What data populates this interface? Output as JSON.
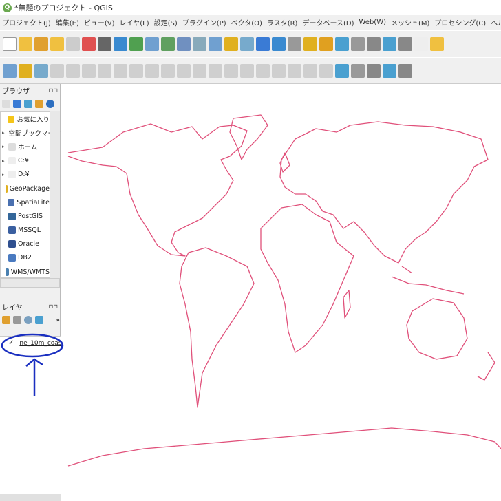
{
  "window": {
    "title": "*無題のプロジェクト - QGIS"
  },
  "menu": [
    "プロジェクト(J)",
    "編集(E)",
    "ビュー(V)",
    "レイヤ(L)",
    "設定(S)",
    "プラグイン(P)",
    "ベクタ(O)",
    "ラスタ(R)",
    "データベース(D)",
    "Web(W)",
    "メッシュ(M)",
    "プロセシング(C)",
    "ヘルプ(H)"
  ],
  "browser": {
    "title": "ブラウザ",
    "items": [
      {
        "label": "お気に入り",
        "color": "#f5c518",
        "arrow": ""
      },
      {
        "label": "空間ブックマーク",
        "color": "#9aa",
        "arrow": "▸"
      },
      {
        "label": "ホーム",
        "color": "#ddd",
        "arrow": "▸"
      },
      {
        "label": "C:¥",
        "color": "#eee",
        "arrow": "▸"
      },
      {
        "label": "D:¥",
        "color": "#eee",
        "arrow": "▸"
      },
      {
        "label": "GeoPackage",
        "color": "#e0b020",
        "arrow": ""
      },
      {
        "label": "SpatiaLite",
        "color": "#4a70b0",
        "arrow": ""
      },
      {
        "label": "PostGIS",
        "color": "#336699",
        "arrow": ""
      },
      {
        "label": "MSSQL",
        "color": "#3a5fa0",
        "arrow": ""
      },
      {
        "label": "Oracle",
        "color": "#2f4f8f",
        "arrow": ""
      },
      {
        "label": "DB2",
        "color": "#4a7ac0",
        "arrow": ""
      },
      {
        "label": "WMS/WMTS",
        "color": "#4a80b0",
        "arrow": ""
      }
    ]
  },
  "layers": {
    "title": "レイヤ",
    "items": [
      {
        "label": "ne_10m_coas",
        "checked": true
      }
    ]
  },
  "colors": {
    "coast": "#e0507a",
    "annotation": "#1a2fc0"
  }
}
